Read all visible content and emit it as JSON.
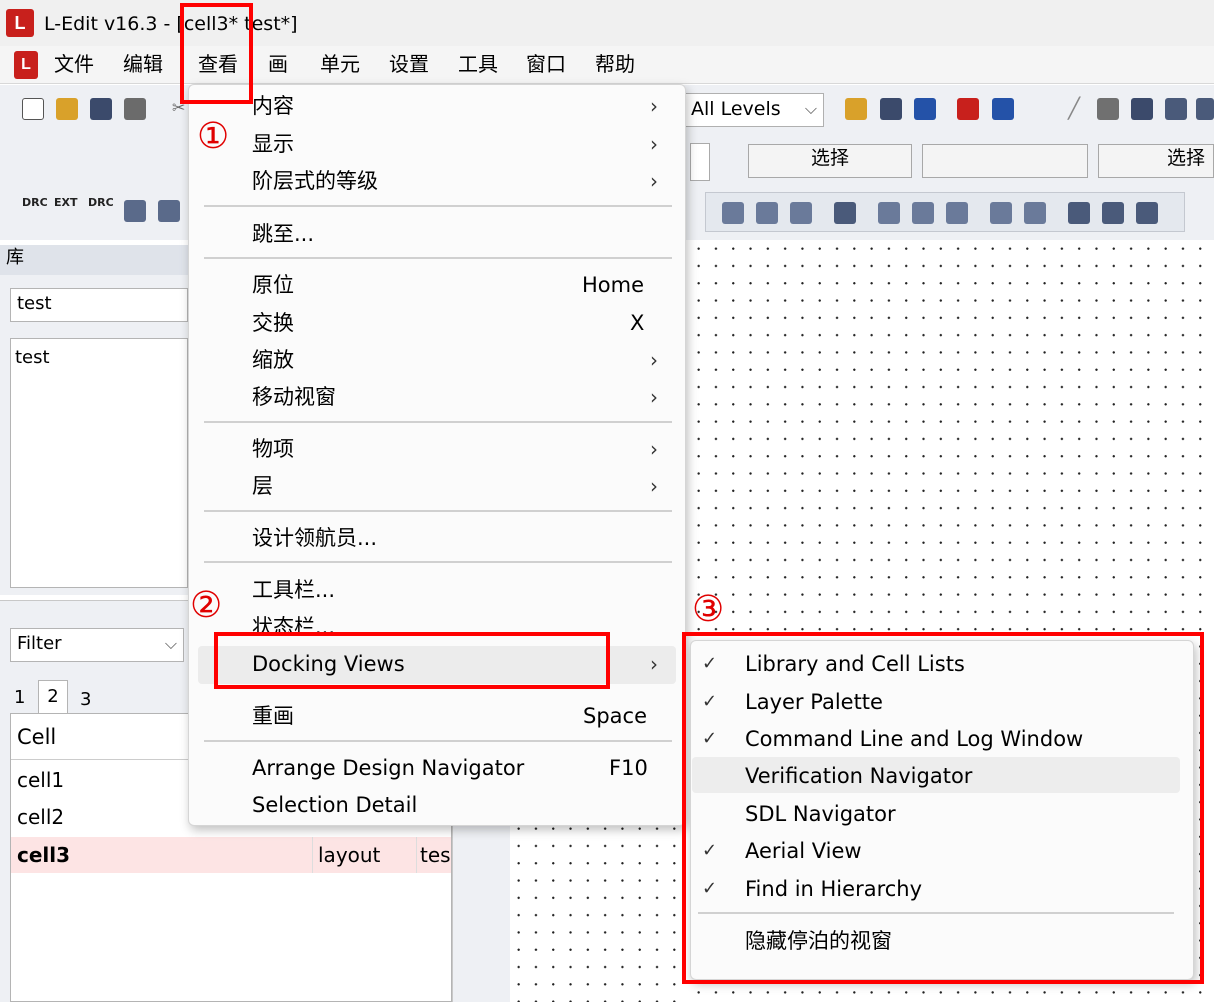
{
  "window": {
    "title": "L-Edit v16.3 - [cell3*      test*]"
  },
  "menubar": {
    "items": [
      "文件",
      "编辑",
      "查看",
      "画",
      "单元",
      "设置",
      "工具",
      "窗口",
      "帮助"
    ]
  },
  "toolbar": {
    "levels_combo": "All Levels",
    "select_label_1": "选择",
    "select_label_2": "选择",
    "drc_labels": [
      "DRC",
      "EXT",
      "DRC"
    ]
  },
  "library_panel": {
    "header": "库",
    "library_name": "test",
    "library_list": [
      "test"
    ]
  },
  "cell_panel": {
    "filter": "Filter",
    "tabs": [
      "1",
      "2",
      "3"
    ],
    "column_header": "Cell",
    "rows": [
      {
        "name": "cell1",
        "view": "",
        "lib": ""
      },
      {
        "name": "cell2",
        "view": "",
        "lib": ""
      },
      {
        "name": "cell3",
        "view": "layout",
        "lib": "tes"
      }
    ]
  },
  "view_menu": {
    "items": {
      "content": "内容",
      "display": "显示",
      "hierarchy_levels": "阶层式的等级",
      "goto": "跳至...",
      "home": "原位",
      "home_shortcut": "Home",
      "exchange": "交换",
      "exchange_shortcut": "X",
      "zoom": "缩放",
      "pan": "移动视窗",
      "objects": "物项",
      "layers": "层",
      "design_navigator": "设计领航员...",
      "toolbars": "工具栏...",
      "statusbar": "状态栏...",
      "docking_views": "Docking Views",
      "redraw": "重画",
      "redraw_shortcut": "Space",
      "arrange_nav": "Arrange Design Navigator",
      "arrange_nav_shortcut": "F10",
      "selection_detail": "Selection Detail"
    }
  },
  "docking_submenu": {
    "items": [
      {
        "label": "Library and Cell Lists",
        "checked": true
      },
      {
        "label": "Layer Palette",
        "checked": true
      },
      {
        "label": "Command Line and Log Window",
        "checked": true
      },
      {
        "label": "Verification Navigator",
        "checked": false
      },
      {
        "label": "SDL Navigator",
        "checked": false
      },
      {
        "label": "Aerial View",
        "checked": true
      },
      {
        "label": "Find in Hierarchy",
        "checked": true
      }
    ],
    "hide_docked": "隐藏停泊的视窗",
    "check_glyph": "✓"
  },
  "annotations": {
    "step1": "①",
    "step2": "②",
    "step3": "③"
  },
  "colors": {
    "highlight_red": "#ff0000",
    "selected_row": "#fde4e4",
    "app_red": "#c8201c"
  }
}
